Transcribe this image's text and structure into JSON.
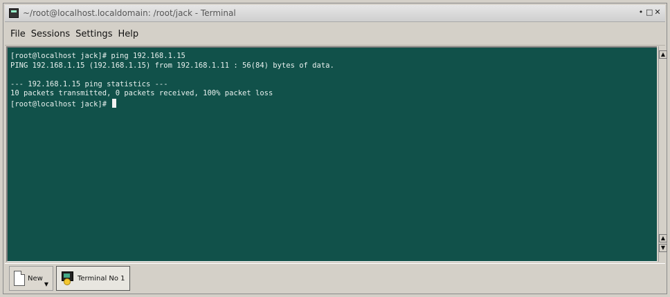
{
  "window": {
    "title": "~/root@localhost.localdomain: /root/jack - Terminal",
    "controls": [
      "•",
      "□",
      "✕"
    ]
  },
  "menubar": {
    "items": [
      "File",
      "Sessions",
      "Settings",
      "Help"
    ]
  },
  "terminal": {
    "lines": [
      "[root@localhost jack]# ping 192.168.1.15",
      "PING 192.168.1.15 (192.168.1.15) from 192.168.1.11 : 56(84) bytes of data.",
      "",
      "--- 192.168.1.15 ping statistics ---",
      "10 packets transmitted, 0 packets received, 100% packet loss"
    ],
    "prompt": "[root@localhost jack]# ",
    "background_color": "#11514a",
    "text_color": "#e8f0ee"
  },
  "scrollbar": {
    "up_arrow": "▲",
    "down_arrow": "▼"
  },
  "tabbar": {
    "new_label": "New",
    "new_arrow": "▼",
    "session_label": "Terminal No 1"
  }
}
